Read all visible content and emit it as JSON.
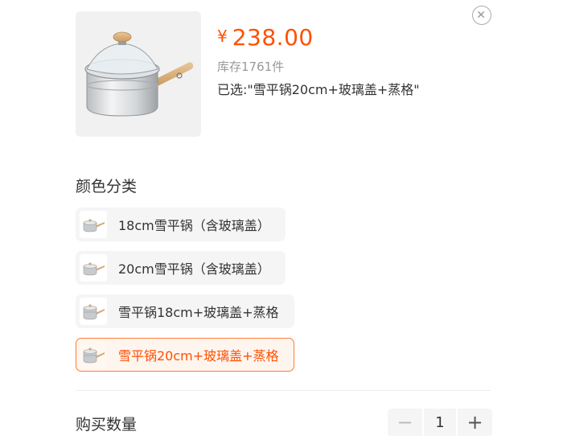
{
  "header": {
    "currency": "¥",
    "price": "238.00",
    "stock": "库存1761件",
    "selected": "已选:\"雪平锅20cm+玻璃盖+蒸格\"",
    "close_icon": "close-icon",
    "image_icon": "saucepan-image"
  },
  "options": {
    "title": "颜色分类",
    "items": [
      {
        "label": "18cm雪平锅（含玻璃盖）",
        "selected": false
      },
      {
        "label": "20cm雪平锅（含玻璃盖）",
        "selected": false
      },
      {
        "label": "雪平锅18cm+玻璃盖+蒸格",
        "selected": false
      },
      {
        "label": "雪平锅20cm+玻璃盖+蒸格",
        "selected": true
      }
    ]
  },
  "quantity": {
    "label": "购买数量",
    "minus": "−",
    "value": "1",
    "plus": "+"
  },
  "colors": {
    "accent": "#ff5000",
    "selected_border": "#ff7a33"
  }
}
